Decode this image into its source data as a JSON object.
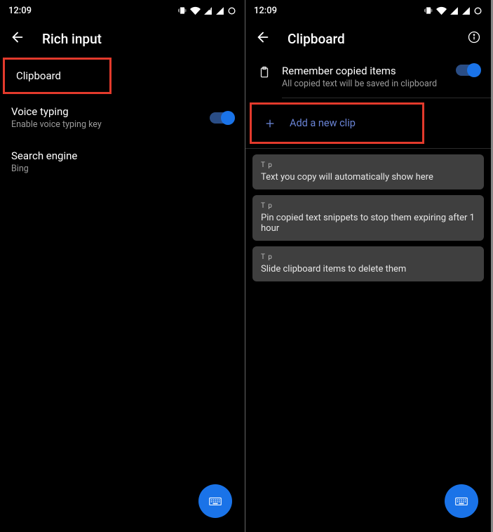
{
  "status": {
    "time": "12:09"
  },
  "left": {
    "header": {
      "title": "Rich input"
    },
    "items": {
      "clipboard": {
        "title": "Clipboard"
      },
      "voice": {
        "title": "Voice typing",
        "sub": "Enable voice typing key"
      },
      "search": {
        "title": "Search engine",
        "sub": "Bing"
      }
    }
  },
  "right": {
    "header": {
      "title": "Clipboard"
    },
    "remember": {
      "title": "Remember copied items",
      "sub": "All copied text will be saved in clipboard"
    },
    "add_clip": {
      "label": "Add a new clip"
    },
    "tips": [
      {
        "label": "T p",
        "text": "Text you copy will automatically show here"
      },
      {
        "label": "T p",
        "text": "Pin copied text snippets to stop them expiring after 1 hour"
      },
      {
        "label": "T p",
        "text": "Slide clipboard items to delete them"
      }
    ]
  }
}
